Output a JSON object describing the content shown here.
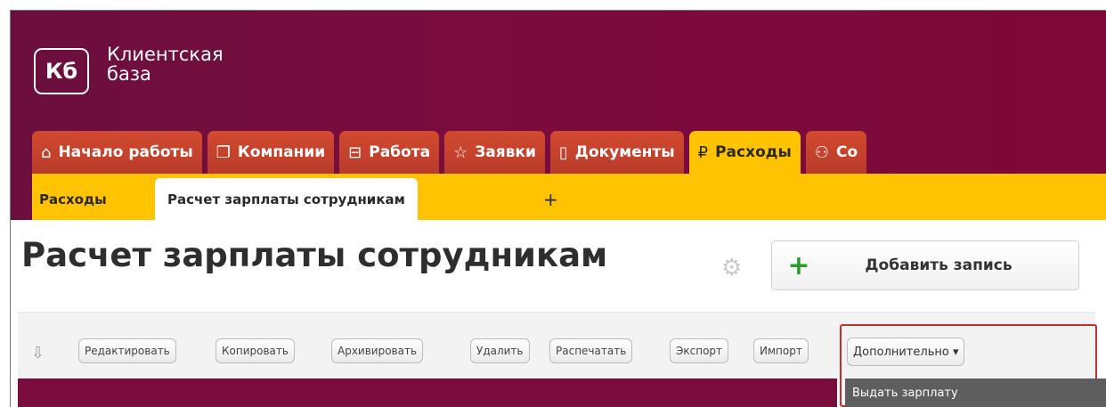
{
  "logo": {
    "mark": "Кб",
    "line1": "Клиентская",
    "line2": "база"
  },
  "tabs": [
    {
      "icon": "⌂",
      "label": "Начало работы"
    },
    {
      "icon": "❐",
      "label": "Компании"
    },
    {
      "icon": "⊟",
      "label": "Работа"
    },
    {
      "icon": "☆",
      "label": "Заявки"
    },
    {
      "icon": "▯",
      "label": "Документы"
    },
    {
      "icon": "₽",
      "label": "Расходы"
    },
    {
      "icon": "⚇",
      "label": "Со"
    }
  ],
  "subtabs": {
    "first": "Расходы",
    "active": "Расчет зарплаты сотрудникам",
    "plus": "+"
  },
  "page": {
    "title": "Расчет зарплаты сотрудникам",
    "add_button": "Добавить запись"
  },
  "toolbar": {
    "buttons": [
      "Редактировать",
      "Копировать",
      "Архивировать",
      "Удалить",
      "Распечатать",
      "Экспорт",
      "Импорт"
    ],
    "more": "Дополнительно ▾",
    "dropdown_first": "Выдать зарплату"
  },
  "colors": {
    "header": "#7a0c3e",
    "tab": "#c9492f",
    "accent": "#ffc300",
    "highlight": "#d12b2b"
  }
}
